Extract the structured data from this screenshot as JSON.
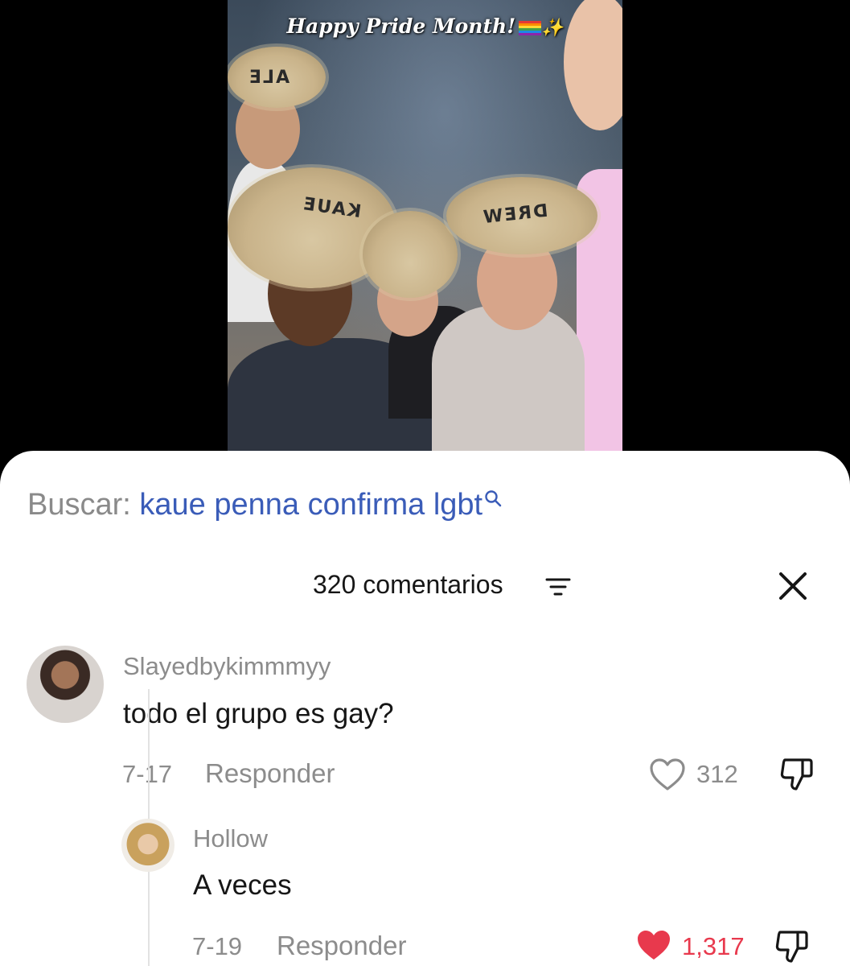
{
  "video": {
    "overlay_title": "Happy Pride Month!",
    "hat_labels": [
      "ALE",
      "KAUE",
      "DREW"
    ]
  },
  "search": {
    "prefix": "Buscar: ",
    "query": "kaue penna confirma lgbt",
    "icon": "search-icon"
  },
  "comments_header": {
    "count_label": "320 comentarios",
    "filter_icon": "filter-icon",
    "close_icon": "close-icon"
  },
  "comments": [
    {
      "username": "Slayedbykimmmyy",
      "text": "todo el grupo es gay?",
      "date": "7-17",
      "reply_label": "Responder",
      "likes": "312",
      "liked": false
    },
    {
      "username": "Hollow",
      "text": "A veces",
      "date": "7-19",
      "reply_label": "Responder",
      "likes": "1,317",
      "liked": true
    }
  ],
  "colors": {
    "query": "#3a5cb8",
    "liked_heart": "#e8394d",
    "muted": "#8c8c8c"
  }
}
